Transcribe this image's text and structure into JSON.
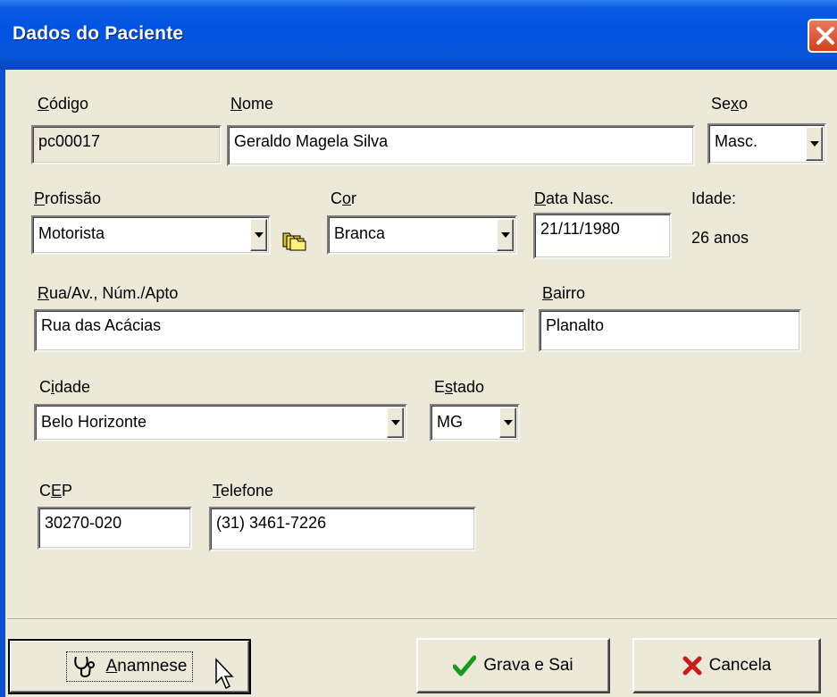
{
  "window": {
    "title": "Dados do Paciente"
  },
  "fields": {
    "codigo": {
      "label_u": "C",
      "label_rest": "ódigo",
      "value": "pc00017"
    },
    "nome": {
      "label_u": "N",
      "label_rest": "ome",
      "value": "Geraldo Magela Silva"
    },
    "sexo": {
      "label_pre": "Se",
      "label_u": "x",
      "label_rest": "o",
      "value": "Masc."
    },
    "profissao": {
      "label_u": "P",
      "label_rest": "rofissão",
      "value": "Motorista"
    },
    "cor": {
      "label_pre": "C",
      "label_u": "o",
      "label_rest": "r",
      "value": "Branca"
    },
    "data_nasc": {
      "label_u": "D",
      "label_rest": "ata Nasc.",
      "value": "21/11/1980"
    },
    "idade": {
      "label": "Idade:",
      "value": "26 anos"
    },
    "rua": {
      "label_u": "R",
      "label_rest": "ua/Av.,  Núm./Apto",
      "value": "Rua das Acácias"
    },
    "bairro": {
      "label_u": "B",
      "label_rest": "airro",
      "value": "Planalto"
    },
    "cidade": {
      "label_pre": "C",
      "label_u": "i",
      "label_rest": "dade",
      "value": "Belo Horizonte"
    },
    "estado": {
      "label_pre": "E",
      "label_u": "s",
      "label_rest": "tado",
      "value": "MG"
    },
    "cep": {
      "label_pre": "C",
      "label_u": "E",
      "label_rest": "P",
      "value": "30270-020"
    },
    "telefone": {
      "label_u": "T",
      "label_rest": "elefone",
      "value": "(31) 3461-7226"
    }
  },
  "buttons": {
    "anamnese": {
      "label_u": "A",
      "label_rest": "namnese",
      "icon": "stethoscope-icon"
    },
    "grava": {
      "label": "Grava e Sai",
      "icon": "checkmark-icon",
      "icon_color": "#1a9a1a"
    },
    "cancela": {
      "label": "Cancela",
      "icon": "x-icon",
      "icon_color": "#cc1a1a"
    }
  },
  "colors": {
    "titlebar": "#0054e3",
    "face": "#ece9d8",
    "close": "#d2421d"
  }
}
